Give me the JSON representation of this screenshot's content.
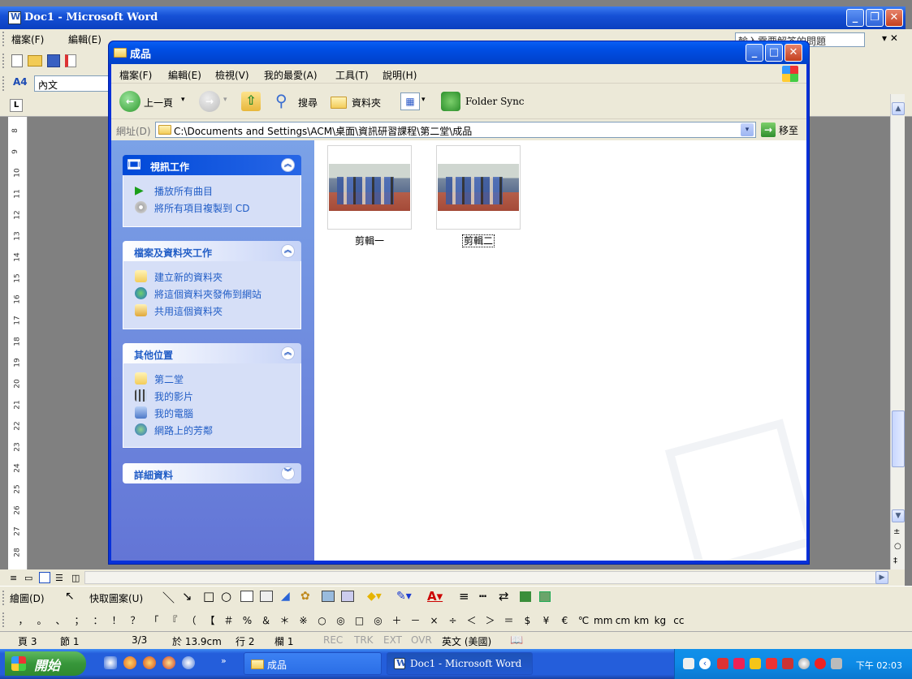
{
  "word": {
    "title": "Doc1 - Microsoft Word",
    "menu": [
      "檔案(F)",
      "編輯(E)"
    ],
    "help_placeholder": "輸入需要解答的問題",
    "style": "內文",
    "ruler_numbers": [
      "8",
      "9",
      "10",
      "11",
      "12",
      "13",
      "14",
      "15",
      "16",
      "17",
      "18",
      "19",
      "20",
      "21",
      "22",
      "23",
      "24",
      "25",
      "26",
      "27",
      "28"
    ],
    "draw_label": "繪圖(D)",
    "autoshape_label": "快取圖案(U)",
    "symbols": [
      "，",
      "。",
      "、",
      "；",
      "：",
      "！",
      "？",
      "「",
      "『",
      "（",
      "【",
      "＃",
      "%",
      "＆",
      "＊",
      "※",
      "○",
      "◎",
      "□",
      "◎",
      "＋",
      "－",
      "×",
      "÷",
      "＜",
      "＞",
      "＝",
      "$",
      "¥",
      "€",
      "℃",
      "mm",
      "cm",
      "km",
      "kg",
      "cc"
    ],
    "status": {
      "page": "頁 3",
      "section": "節 1",
      "pages": "3/3",
      "at": "於 13.9cm",
      "line": "行 2",
      "col": "欄 1",
      "rec": "REC",
      "trk": "TRK",
      "ext": "EXT",
      "ovr": "OVR",
      "lang": "英文 (美國)"
    }
  },
  "explorer": {
    "title": "成品",
    "menu": [
      "檔案(F)",
      "編輯(E)",
      "檢視(V)",
      "我的最愛(A)",
      "工具(T)",
      "說明(H)"
    ],
    "toolbar": {
      "back": "上一頁",
      "search": "搜尋",
      "folders": "資料夾",
      "folder_sync": "Folder Sync"
    },
    "address_label": "網址(D)",
    "address": "C:\\Documents and Settings\\ACM\\桌面\\資訊研習課程\\第二堂\\成品",
    "go_label": "移至",
    "taskpane": [
      {
        "title": "視訊工作",
        "items": [
          "播放所有曲目",
          "將所有項目複製到 CD"
        ]
      },
      {
        "title": "檔案及資料夾工作",
        "items": [
          "建立新的資料夾",
          "將這個資料夾發佈到網站",
          "共用這個資料夾"
        ]
      },
      {
        "title": "其他位置",
        "items": [
          "第二堂",
          "我的影片",
          "我的電腦",
          "網路上的芳鄰"
        ]
      },
      {
        "title": "詳細資料",
        "items": []
      }
    ],
    "files": [
      "剪輯一",
      "剪輯二"
    ]
  },
  "taskbar": {
    "start": "開始",
    "tasks": [
      "成品",
      "Doc1 - Microsoft Word"
    ],
    "clock": "下午 02:03"
  },
  "colors": {
    "xp_blue": "#0831d9",
    "taskpane_link": "#215dc6",
    "start_green": "#37963a"
  }
}
